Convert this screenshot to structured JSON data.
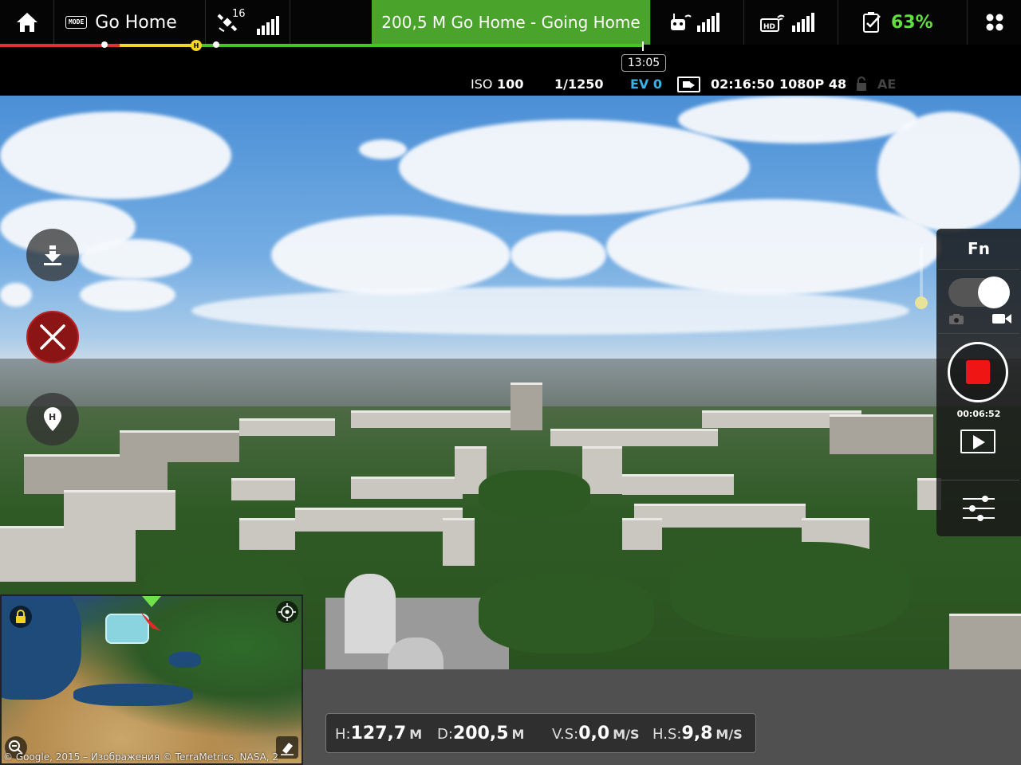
{
  "topbar": {
    "mode_badge": "MODE",
    "mode": "Go Home",
    "gps_satellites": "16",
    "status": "200,5 M Go Home - Going Home",
    "battery_percent": "63%",
    "home_marker": "H",
    "flight_time": "13:05",
    "colors": {
      "status_bg": "#4aa32b",
      "battery": "#5fe03a",
      "track_red": "#e03030",
      "track_yellow": "#f3d323",
      "track_green": "#4ac22b"
    }
  },
  "camera": {
    "iso_label": "ISO",
    "iso_value": "100",
    "shutter": "1/1250",
    "ev": "EV 0",
    "record_time": "02:16:50",
    "video_format": "1080P 48",
    "ae_label": "AE",
    "ev_color": "#3bb2e8"
  },
  "left_controls": [
    {
      "name": "land",
      "icon": "download-land-icon"
    },
    {
      "name": "cancel",
      "icon": "close-icon"
    },
    {
      "name": "home-point",
      "icon": "home-pin-icon"
    }
  ],
  "right_panel": {
    "fn_label": "Fn",
    "photo_icon": "camera-icon",
    "video_icon": "video-camera-icon",
    "rec_elapsed": "00:06:52",
    "playback_icon": "play-icon",
    "settings_icon": "sliders-icon",
    "stop_color": "#f01515"
  },
  "map": {
    "credit": "© Google, 2015 – Изображения © TerraMetrics, NASA, 2"
  },
  "telemetry": {
    "height_label": "H:",
    "height_value": "127,7",
    "height_unit": "M",
    "distance_label": "D:",
    "distance_value": "200,5",
    "distance_unit": "M",
    "vspeed_label": "V.S:",
    "vspeed_value": "0,0",
    "vspeed_unit": "M/S",
    "hspeed_label": "H.S:",
    "hspeed_value": "9,8",
    "hspeed_unit": "M/S"
  }
}
